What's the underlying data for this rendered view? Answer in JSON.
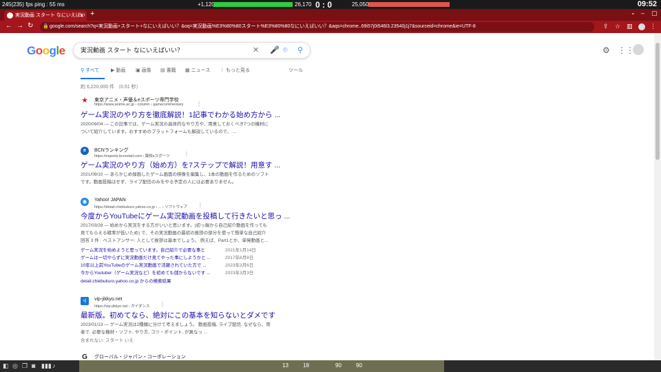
{
  "hud": {
    "fps": "245(235) fps  ping : 55 ms",
    "left_count": "+1,120",
    "left_total": "26,170",
    "score": "0 : 0",
    "right_total": "25,050",
    "clock": "09:52"
  },
  "browser": {
    "tab_title": "実況動画 スタート なにいえばいい？",
    "url": "google.com/search?q=実況動画+スタート+なにいえばいい？&oq=実況動画%E3%80%80スタート%E3%80%80なにいえばいい？&aqs=chrome..69i57j0i546l3.23540j1j7&sourceid=chrome&ie=UTF-8"
  },
  "google": {
    "logo_letters": [
      "G",
      "o",
      "o",
      "g",
      "l",
      "e"
    ],
    "logo_colors": [
      "#4285f4",
      "#ea4335",
      "#fbbc05",
      "#4285f4",
      "#34a853",
      "#ea4335"
    ],
    "query": "実況動画 スタート なにいえばいい？",
    "tabs": [
      {
        "label": "すべて",
        "icon": "search-icon",
        "active": true
      },
      {
        "label": "動画",
        "icon": "video-icon"
      },
      {
        "label": "画像",
        "icon": "image-icon"
      },
      {
        "label": "書籍",
        "icon": "book-icon"
      },
      {
        "label": "ニュース",
        "icon": "news-icon"
      },
      {
        "label": "もっと見る",
        "icon": "more-vert-icon"
      }
    ],
    "tools": "ツール",
    "stats": "約 6,220,000 件 （0.51 秒）"
  },
  "results": [
    {
      "site": "東京アニメ・声優＆eスポーツ専門学校",
      "url": "https://www.anime.ac.jp › column › gamecommentary",
      "title": "ゲーム実況のやり方を徹底解説！1記事でわかる始め方から ...",
      "snippet": [
        "2020/09/04 — この記事では、ゲーム実況の具体的なやり方や、用意しておくべき7つの機材に",
        "ついて紹介しています。おすすめのプラットフォームも解説しているので、 ..."
      ],
      "color": "#c62828"
    },
    {
      "site": "BCNランキング",
      "url": "https://esports.bcnretail.com › 異校eスポーツ",
      "title": "ゲーム実況のやり方（始め方）を7ステップで解説！用意す ...",
      "snippet": [
        "2021/09/10 — あらかじめ録画したゲーム画面の映像を編集し、1本の動画を作るためのソフト",
        "です。動画投稿はせず、ライブ配信のみをやる予定の人には必要ありません。"
      ],
      "color": "#1565c0"
    },
    {
      "site": "Yahoo! JAPAN",
      "url": "https://detail.chiebukuro.yahoo.co.jp › ... › ソフトウェア",
      "title": "今度からYouTubeにゲーム実況動画を投稿して行きたいと思っ ...",
      "snippet": [
        "2017/03/28 — 始めから実況をする方がいいと思います。(初っ端から自己紹介動画を作っても",
        "見てもらえる確率が低いため) で、その実況動画の最初の挨拶の部分を使って簡単な自己紹介",
        "回答 3 件 · ベストアンサー: 人として挨拶は基本でしょう。 例えば、Part1とか、単発動画と..."
      ],
      "color": "#1e88e5",
      "subs": [
        {
          "text": "ゲーム実況を始めようと思っています。自己紹介で必要な事と",
          "date": "2021年1月14日"
        },
        {
          "text": "ゲームは一切やらずに実況動画だけ見てやった事にしようかと ...",
          "date": "2017年8月8日"
        },
        {
          "text": "10年以上前YouTubeのゲーム実況動画で活躍されていた方で ...",
          "date": "2023年3月6日"
        },
        {
          "text": "今からYoutuber（ゲーム実況など）を初めても儲からないです ...",
          "date": "2023年3月3日"
        }
      ],
      "more": "detail.chiebukuro.yahoo.co.jp からの検索結果"
    },
    {
      "site": "vip-jikkyo.net",
      "url": "https://vip-jikkyo.net › ガイダンス",
      "title": "最新版。初めてなら、絶対にこの基本を知らないとダメです",
      "snippet": [
        "2023/01/13 — ゲーム実況は2種類に分けて考えましょう。 動画投稿, ライブ配信. なぜなら、両",
        "者で. 必要な機材・ソフト, やり方, コツ・ポイント, が異なっ ..."
      ],
      "missing": "含まれない: スタート いえ",
      "color": "#1976d2"
    },
    {
      "site": "グローバル・ジャパン・コーポレーション",
      "color": "#212121"
    }
  ],
  "taskbar": {
    "counts": [
      "13",
      "18",
      "90",
      "90"
    ]
  }
}
